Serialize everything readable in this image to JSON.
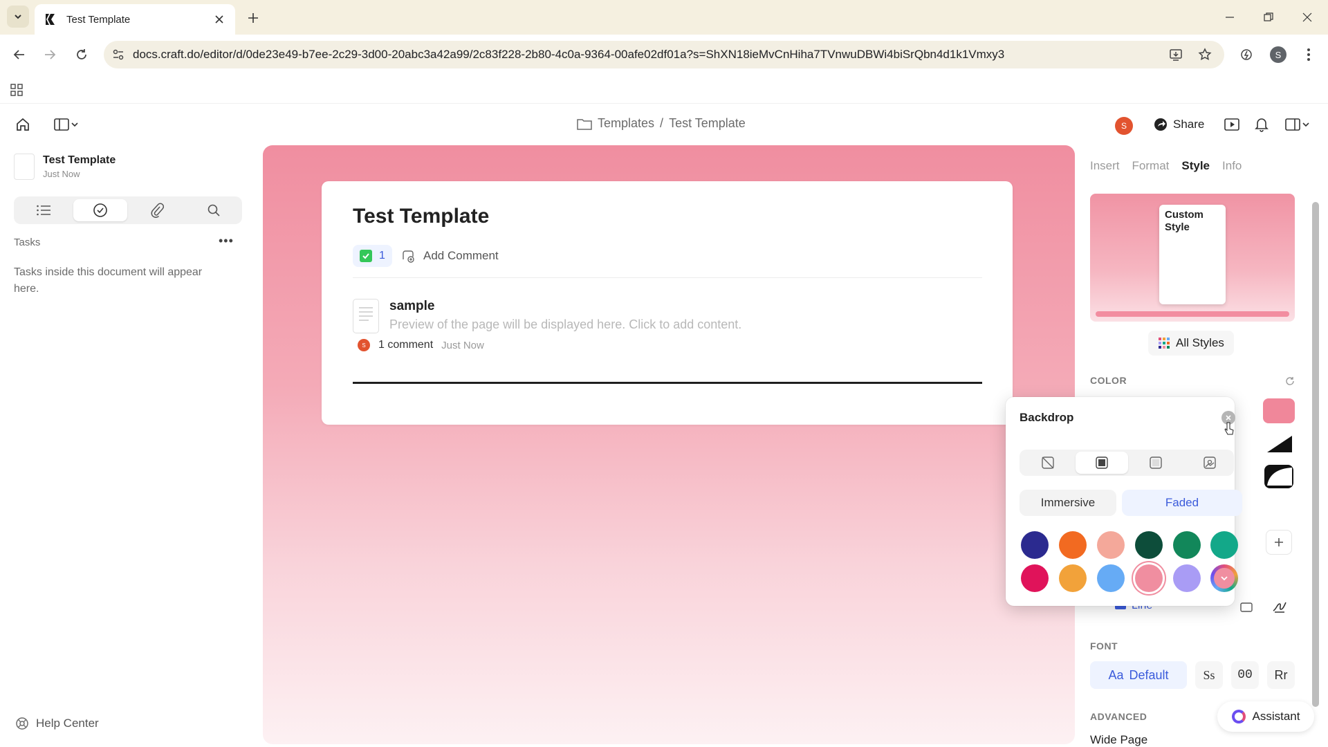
{
  "browser": {
    "tab_title": "Test Template",
    "url": "docs.craft.do/editor/d/0de23e49-b7ee-2c29-3d00-20abc3a42a99/2c83f228-2b80-4c0a-9364-00afe02df01a?s=ShXN18ieMvCnHiha7TVnwuDBWi4biSrQbn4d1k1Vmxy3",
    "profile_initial": "S"
  },
  "app": {
    "breadcrumb": {
      "folder": "Templates",
      "separator": "/",
      "current": "Test Template"
    },
    "share_label": "Share",
    "user_initial": "S"
  },
  "sidebar": {
    "doc_title": "Test Template",
    "doc_subtitle": "Just Now",
    "tasks_heading": "Tasks",
    "tasks_more": "•••",
    "tasks_empty": "Tasks inside this document will appear here.",
    "help_label": "Help Center"
  },
  "document": {
    "title": "Test Template",
    "task_count": "1",
    "add_comment_label": "Add Comment",
    "subpage": {
      "title": "sample",
      "preview": "Preview of the page will be displayed here. Click to add content.",
      "comment_count": "1 comment",
      "comment_time": "Just Now",
      "comment_avatar": "S"
    }
  },
  "panel": {
    "tabs": [
      "Insert",
      "Format",
      "Style",
      "Info"
    ],
    "active_tab": "Style",
    "preview_label": "Custom Style",
    "all_styles_label": "All Styles",
    "color_heading": "COLOR",
    "line_label": "Line",
    "font_heading": "FONT",
    "font_options": {
      "default": "Default",
      "default_prefix": "Aa",
      "serif": "Ss",
      "mono": "00",
      "rounded": "Rr"
    },
    "advanced_heading": "ADVANCED",
    "wide_page_label": "Wide Page",
    "assistant_label": "Assistant",
    "accent_color": "#f0879a"
  },
  "backdrop_popover": {
    "title": "Backdrop",
    "modes": [
      "Immersive",
      "Faded"
    ],
    "selected_mode": "Faded",
    "colors": [
      "#2b2a8f",
      "#f26a21",
      "#f4a89a",
      "#0d4d3a",
      "#12875a",
      "#13a889",
      "#e0135a",
      "#f2a23a",
      "#66abf5",
      "#f08ea0",
      "#a99cf5",
      "#e24e7a"
    ],
    "selected_color": "#f08ea0"
  }
}
